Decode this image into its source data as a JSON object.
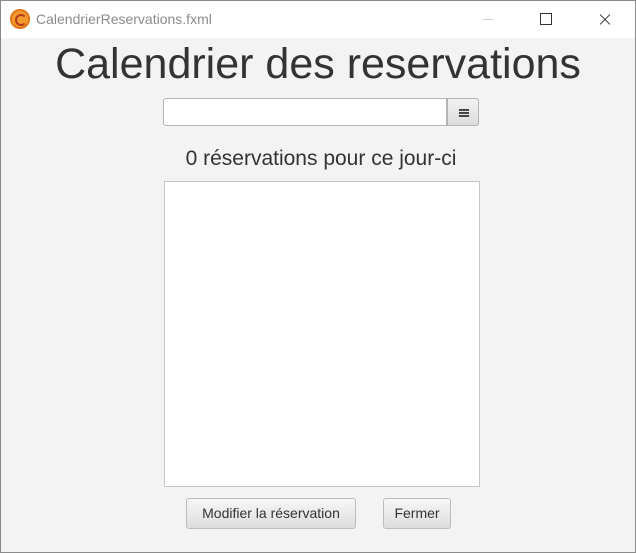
{
  "window": {
    "title": "CalendrierReservations.fxml"
  },
  "heading": "Calendrier des reservations",
  "date_picker": {
    "value": "",
    "placeholder": "",
    "icon": "calendar-icon"
  },
  "reservation_count_label": "0 réservations pour ce jour-ci",
  "reservations": [],
  "buttons": {
    "modify": "Modifier la réservation",
    "close": "Fermer"
  },
  "colors": {
    "app_icon": "#f29a2e",
    "background": "#f3f3f3"
  }
}
